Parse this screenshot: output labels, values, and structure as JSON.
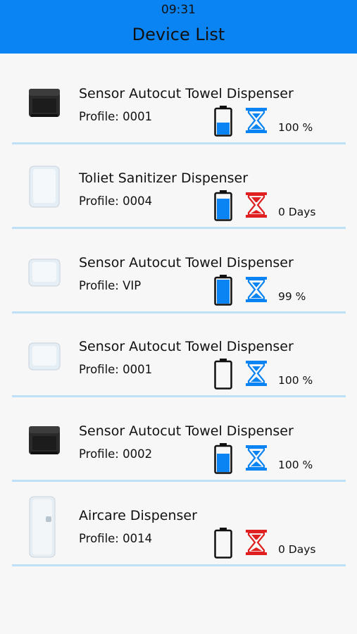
{
  "status_bar": {
    "time": "09:31"
  },
  "header": {
    "title": "Device List"
  },
  "colors": {
    "accent": "#0b84f3",
    "battery_fill": "#0b84f3",
    "timer_ok": "#0b84f3",
    "timer_empty": "#e02020",
    "divider": "#bfe1f7"
  },
  "devices": [
    {
      "name": "Sensor Autocut Towel Dispenser",
      "profile": "Profile: 0001",
      "image": "black-towel-dispenser-image",
      "battery_level": 0.5,
      "timer_status": "ok",
      "level": "100 %"
    },
    {
      "name": "Toliet Sanitizer Dispenser",
      "profile": "Profile: 0004",
      "image": "white-sanitizer-dispenser-image",
      "battery_level": 0.85,
      "timer_status": "empty",
      "level": "0 Days"
    },
    {
      "name": "Sensor Autocut Towel Dispenser",
      "profile": "Profile: VIP",
      "image": "white-towel-dispenser-image",
      "battery_level": 1.0,
      "timer_status": "ok",
      "level": "99 %"
    },
    {
      "name": "Sensor Autocut Towel Dispenser",
      "profile": "Profile: 0001",
      "image": "white-towel-dispenser-image",
      "battery_level": 0.0,
      "timer_status": "ok",
      "level": "100 %"
    },
    {
      "name": "Sensor Autocut Towel Dispenser",
      "profile": "Profile: 0002",
      "image": "black-towel-dispenser-image",
      "battery_level": 0.75,
      "timer_status": "ok",
      "level": "100 %"
    },
    {
      "name": "Aircare Dispenser",
      "profile": "Profile: 0014",
      "image": "white-aircare-dispenser-image",
      "battery_level": 0.0,
      "timer_status": "empty",
      "level": "0 Days"
    }
  ]
}
